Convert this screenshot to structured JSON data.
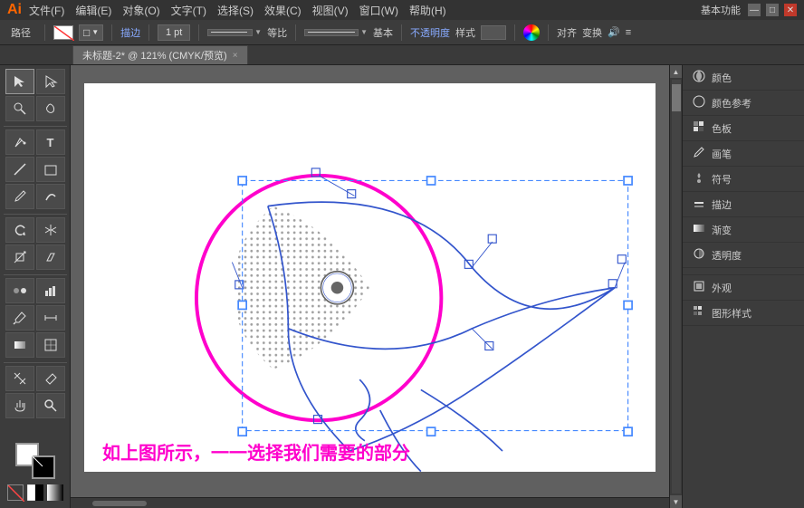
{
  "titlebar": {
    "logo": "Ai",
    "menus": [
      "文件(F)",
      "编辑(E)",
      "对象(O)",
      "文字(T)",
      "选择(S)",
      "效果(C)",
      "视图(V)",
      "窗口(W)",
      "帮助(H)"
    ],
    "mode_label": "基本功能",
    "win_min": "—",
    "win_max": "□",
    "win_close": "✕"
  },
  "toolbar": {
    "path_label": "路径",
    "stroke_icon": "✏",
    "shape_icon": "□",
    "mode_label": "描边",
    "stroke_width": "1 pt",
    "line_style": "等比",
    "dash_style": "基本",
    "opacity_label": "不透明度",
    "style_label": "样式",
    "align_label": "对齐",
    "transform_label": "变换"
  },
  "tab": {
    "title": "未标题-2* @ 121% (CMYK/预览)",
    "close": "×"
  },
  "tools": [
    {
      "name": "select",
      "icon": "↖",
      "title": "选择工具"
    },
    {
      "name": "direct-select",
      "icon": "↗",
      "title": "直接选择"
    },
    {
      "name": "pen",
      "icon": "✒",
      "title": "钢笔"
    },
    {
      "name": "type",
      "icon": "T",
      "title": "文字"
    },
    {
      "name": "line",
      "icon": "╱",
      "title": "直线"
    },
    {
      "name": "shape",
      "icon": "◻",
      "title": "形状"
    },
    {
      "name": "pencil",
      "icon": "✏",
      "title": "铅笔"
    },
    {
      "name": "rotate",
      "icon": "↻",
      "title": "旋转"
    },
    {
      "name": "scale",
      "icon": "⇲",
      "title": "缩放"
    },
    {
      "name": "blend",
      "icon": "◈",
      "title": "混合"
    },
    {
      "name": "eraser",
      "icon": "◻",
      "title": "橡皮擦"
    },
    {
      "name": "eyedropper",
      "icon": "💧",
      "title": "吸管"
    },
    {
      "name": "gradient",
      "icon": "▣",
      "title": "渐变"
    },
    {
      "name": "mesh",
      "icon": "⊞",
      "title": "网格"
    },
    {
      "name": "chart",
      "icon": "📊",
      "title": "图表"
    },
    {
      "name": "slice",
      "icon": "◱",
      "title": "切片"
    },
    {
      "name": "pan",
      "icon": "✋",
      "title": "抓手"
    },
    {
      "name": "zoom",
      "icon": "🔍",
      "title": "缩放"
    }
  ],
  "right_panel": {
    "items": [
      {
        "icon": "🎨",
        "label": "颜色"
      },
      {
        "icon": "🎨",
        "label": "颜色参考"
      },
      {
        "icon": "▦",
        "label": "色板"
      },
      {
        "icon": "✏",
        "label": "画笔"
      },
      {
        "icon": "✿",
        "label": "符号"
      },
      {
        "icon": "—",
        "label": "描边"
      },
      {
        "icon": "▒",
        "label": "渐变"
      },
      {
        "icon": "◎",
        "label": "透明度"
      },
      {
        "icon": "◻",
        "label": "外观"
      },
      {
        "icon": "⊞",
        "label": "图形样式"
      }
    ]
  },
  "caption": "如上图所示，一一选择我们需要的部分",
  "illustration": {
    "circle_color": "#ff00cc",
    "path_color": "#3355cc",
    "fill_color": "#888888",
    "selection_color": "#4488ff"
  }
}
